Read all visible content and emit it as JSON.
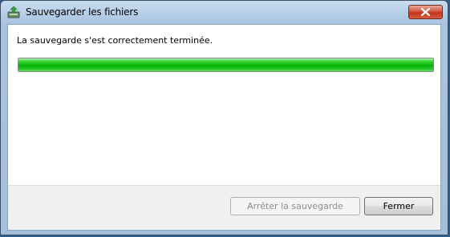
{
  "window": {
    "title": "Sauvegarder les fichiers",
    "icon": "backup-icon"
  },
  "main": {
    "message": "La sauvegarde s'est correctement terminée.",
    "progress_percent": 100,
    "progress_color": "#06b006"
  },
  "footer": {
    "stop_label": "Arrêter la sauvegarde",
    "stop_enabled": false,
    "close_label": "Fermer"
  }
}
